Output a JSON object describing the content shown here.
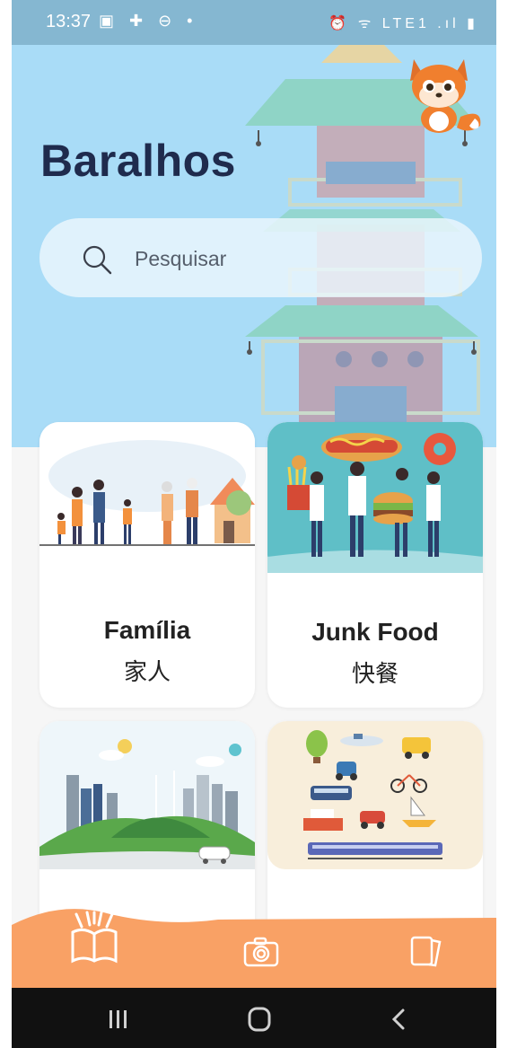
{
  "status_bar": {
    "time": "13:37",
    "left_icons": "▣ ✚ ⊖ •",
    "right_icons": "⏰ ᯤ LTE1 .ıl ▮"
  },
  "header": {
    "title": "Baralhos"
  },
  "search": {
    "placeholder": "Pesquisar"
  },
  "decks": [
    {
      "title": "Família",
      "subtitle": "家人",
      "image": "family-illustration"
    },
    {
      "title": "Junk Food",
      "subtitle": "快餐",
      "image": "junk-food-illustration"
    },
    {
      "title": "",
      "subtitle": "",
      "image": "city-illustration"
    },
    {
      "title": "",
      "subtitle": "",
      "image": "transport-illustration"
    }
  ],
  "bottom_nav": [
    {
      "icon": "open-book-icon",
      "active": true
    },
    {
      "icon": "camera-icon",
      "active": false
    },
    {
      "icon": "cards-icon",
      "active": false
    }
  ],
  "colors": {
    "hero_bg": "#a9dcf7",
    "title": "#1f2b4d",
    "accent": "#f9a165",
    "page_bg": "#f6f6f6"
  }
}
